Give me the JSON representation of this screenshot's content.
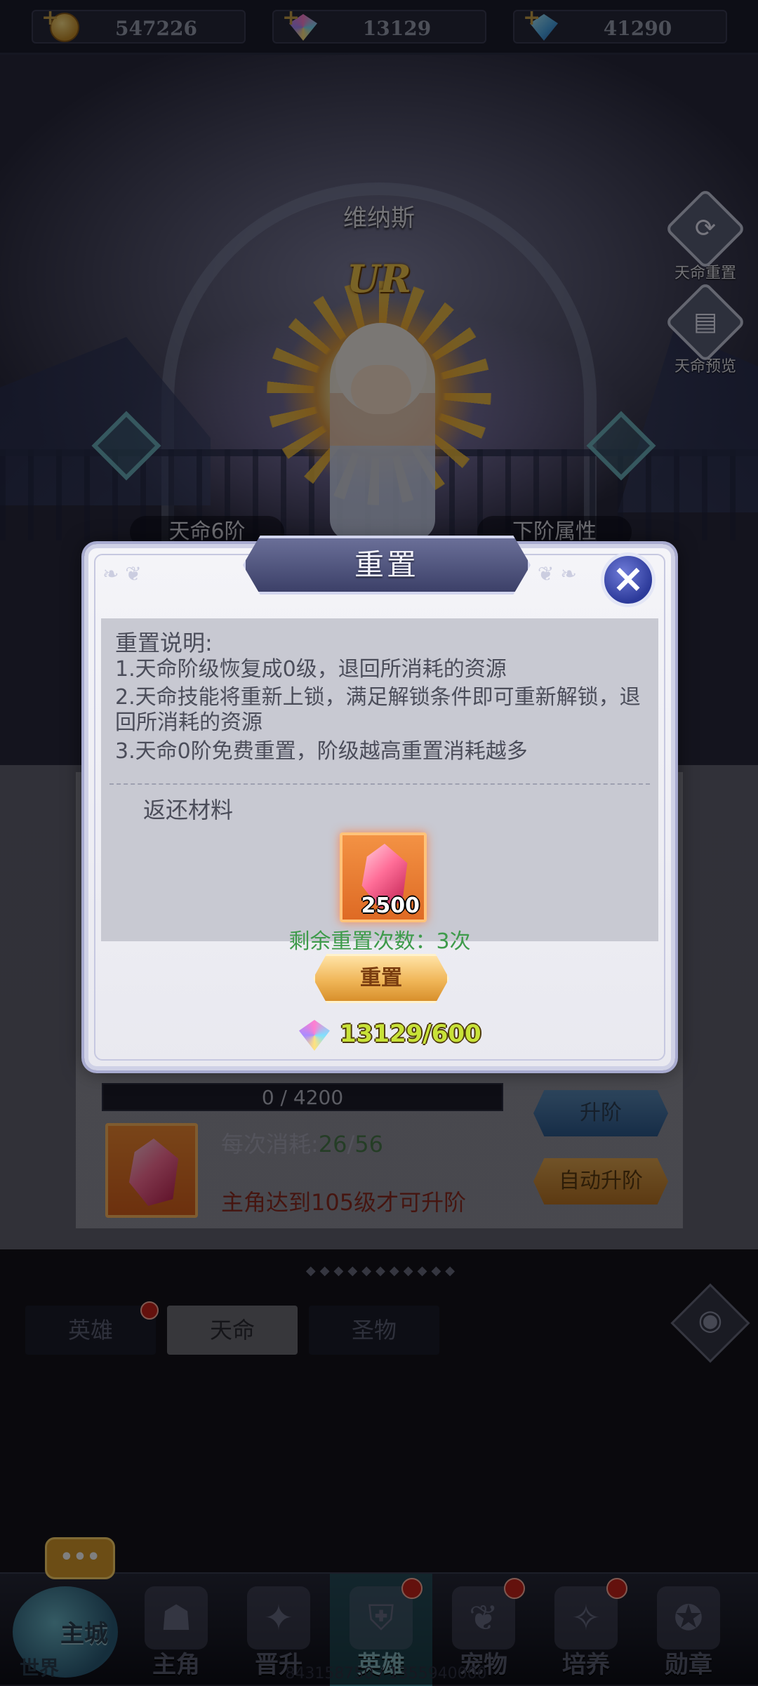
{
  "resources": [
    {
      "icon": "gold-coin-icon",
      "value": "547226"
    },
    {
      "icon": "rainbow-gem-icon",
      "value": "13129"
    },
    {
      "icon": "blue-diamond-icon",
      "value": "41290"
    }
  ],
  "hero": {
    "name": "维纳斯",
    "rarity": "UR",
    "current_tag": "天命6阶",
    "next_tag": "下阶属性"
  },
  "side_buttons": {
    "reset": "天命重置",
    "preview": "天命预览"
  },
  "upgrade": {
    "progress_text": "0 / 4200",
    "progress_fraction": 0,
    "cost_label": "每次消耗:",
    "cost_have": "26",
    "cost_sep": "/",
    "cost_need": "56",
    "requirement": "主角达到105级才可升阶",
    "upgrade_button": "升阶",
    "auto_button": "自动升阶"
  },
  "tabs": [
    {
      "label": "英雄",
      "active": false,
      "badge": true
    },
    {
      "label": "天命",
      "active": true,
      "badge": false
    },
    {
      "label": "圣物",
      "active": false,
      "badge": false
    }
  ],
  "bottom_nav": {
    "city": {
      "main": "主城",
      "world": "世界",
      "chat": "•••"
    },
    "items": [
      {
        "label": "主角",
        "icon": "protagonist-icon",
        "active": false,
        "badge": false
      },
      {
        "label": "晋升",
        "icon": "promotion-icon",
        "active": false,
        "badge": false
      },
      {
        "label": "英雄",
        "icon": "hero-helmet-icon",
        "active": true,
        "badge": true
      },
      {
        "label": "宠物",
        "icon": "pet-icon",
        "active": false,
        "badge": true
      },
      {
        "label": "培养",
        "icon": "cultivate-icon",
        "active": false,
        "badge": true
      },
      {
        "label": "勋章",
        "icon": "medal-icon",
        "active": false,
        "badge": false
      }
    ]
  },
  "uid_text": "843158750 / 1355940000",
  "modal": {
    "title": "重置",
    "desc_heading": "重置说明:",
    "desc_lines": [
      "1.天命阶级恢复成0级，退回所消耗的资源",
      "2.天命技能将重新上锁，满足解锁条件即可重新解锁，退回所消耗的资源",
      "3.天命0阶免费重置，阶级越高重置消耗越多"
    ],
    "return_label": "返还材料",
    "return_item": {
      "icon": "pink-crystal-icon",
      "quantity": "2500"
    },
    "remaining": "剩余重置次数：3次",
    "reset_button": "重置",
    "cost_display": "13129/600"
  },
  "colors": {
    "remaining_green": "#3e9b4b",
    "cost_yellow": "#c8e238",
    "warning_red": "#8b2a20"
  }
}
